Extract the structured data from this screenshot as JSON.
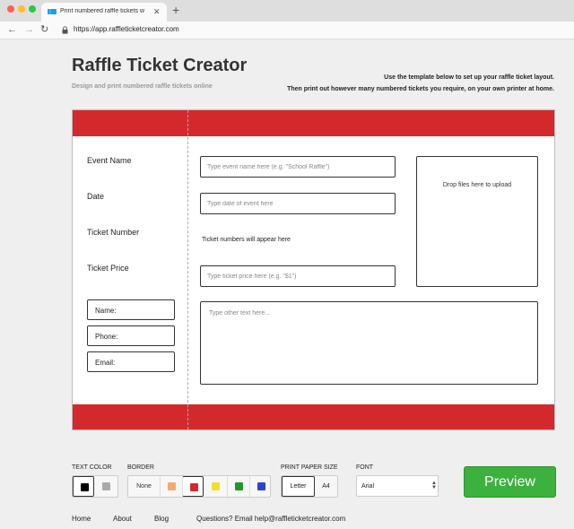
{
  "browser": {
    "tab_title": "Print numbered raffle tickets w",
    "url": "https://app.raffleticketcreator.com"
  },
  "header": {
    "title": "Raffle Ticket Creator",
    "subtitle": "Design and print numbered raffle tickets online",
    "intro_line1": "Use the template below to set up your raffle ticket layout.",
    "intro_line2": "Then print out however many numbered tickets you require, on your own printer at home."
  },
  "ticket": {
    "band_color": "#d3292d",
    "stub": {
      "event_name_label": "Event Name",
      "date_label": "Date",
      "ticket_number_label": "Ticket Number",
      "ticket_price_label": "Ticket Price",
      "name_label": "Name:",
      "phone_label": "Phone:",
      "email_label": "Email:"
    },
    "event_name_placeholder": "Type event name here (e.g. \"School Raffle\")",
    "date_placeholder": "Type date of event here",
    "ticket_number_note": "Ticket numbers will appear here",
    "ticket_price_placeholder": "Type ticket price here (e.g. \"$1\")",
    "dropzone_text": "Drop files here to upload",
    "other_text_placeholder": "Type other text here..."
  },
  "controls": {
    "text_color_label": "TEXT COLOR",
    "text_colors": [
      "#000000",
      "#aaaaaa"
    ],
    "border_label": "BORDER",
    "border_none_label": "None",
    "border_colors": [
      "#f3a96e",
      "#d3292d",
      "#f0e02c",
      "#1f9a27",
      "#2c46c8"
    ],
    "paper_size_label": "PRINT PAPER SIZE",
    "paper_letter": "Letter",
    "paper_a4": "A4",
    "font_label": "FONT",
    "font_value": "Arial",
    "preview_label": "Preview"
  },
  "footer": {
    "home": "Home",
    "about": "About",
    "blog": "Blog",
    "questions": "Questions? Email help@raffleticketcreator.com"
  }
}
